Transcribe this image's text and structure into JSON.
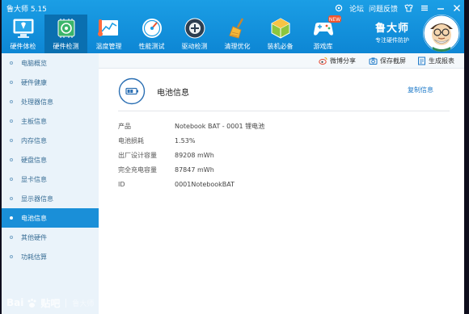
{
  "window": {
    "title": "鲁大师 5.15",
    "forum_link": "论坛",
    "feedback_link": "问题反馈"
  },
  "toolbar": {
    "items": [
      {
        "label": "硬件体检",
        "icon": "hardware-checkup-icon"
      },
      {
        "label": "硬件检测",
        "icon": "hardware-detect-icon"
      },
      {
        "label": "温度管理",
        "icon": "temperature-icon"
      },
      {
        "label": "性能测试",
        "icon": "performance-icon"
      },
      {
        "label": "驱动检测",
        "icon": "driver-icon"
      },
      {
        "label": "清理优化",
        "icon": "broom-icon"
      },
      {
        "label": "装机必备",
        "icon": "apps-icon"
      },
      {
        "label": "游戏库",
        "icon": "gamepad-icon",
        "badge": "NEW"
      }
    ],
    "active_index": 1
  },
  "brand": {
    "name": "鲁大师",
    "slogan": "专注硬件防护"
  },
  "sidebar": {
    "items": [
      {
        "label": "电脑概览"
      },
      {
        "label": "硬件健康"
      },
      {
        "label": "处理器信息"
      },
      {
        "label": "主板信息"
      },
      {
        "label": "内存信息"
      },
      {
        "label": "硬盘信息"
      },
      {
        "label": "显卡信息"
      },
      {
        "label": "显示器信息"
      },
      {
        "label": "电池信息"
      },
      {
        "label": "其他硬件"
      },
      {
        "label": "功耗估算"
      }
    ],
    "active_index": 8
  },
  "actions": {
    "weibo_share": "微博分享",
    "save_screenshot": "保存截屏",
    "generate_report": "生成报表"
  },
  "section": {
    "title": "电池信息",
    "copy_label": "复制信息",
    "rows": [
      {
        "key": "产品",
        "value": "Notebook BAT - 0001 锂电池"
      },
      {
        "key": "电池损耗",
        "value": "1.53%"
      },
      {
        "key": "出厂设计容量",
        "value": "89208 mWh"
      },
      {
        "key": "完全充电容量",
        "value": "87847 mWh"
      },
      {
        "key": "ID",
        "value": "0001NotebookBAT"
      }
    ]
  },
  "watermark": {
    "brand": "Bai",
    "brand_tail": "贴吧",
    "sub": "鲁大师"
  },
  "colors": {
    "toolbar": "#0d86d4",
    "toolbar_active": "#0a6fb0",
    "sidebar_active": "#1a8fd8",
    "link": "#1d79c8"
  }
}
